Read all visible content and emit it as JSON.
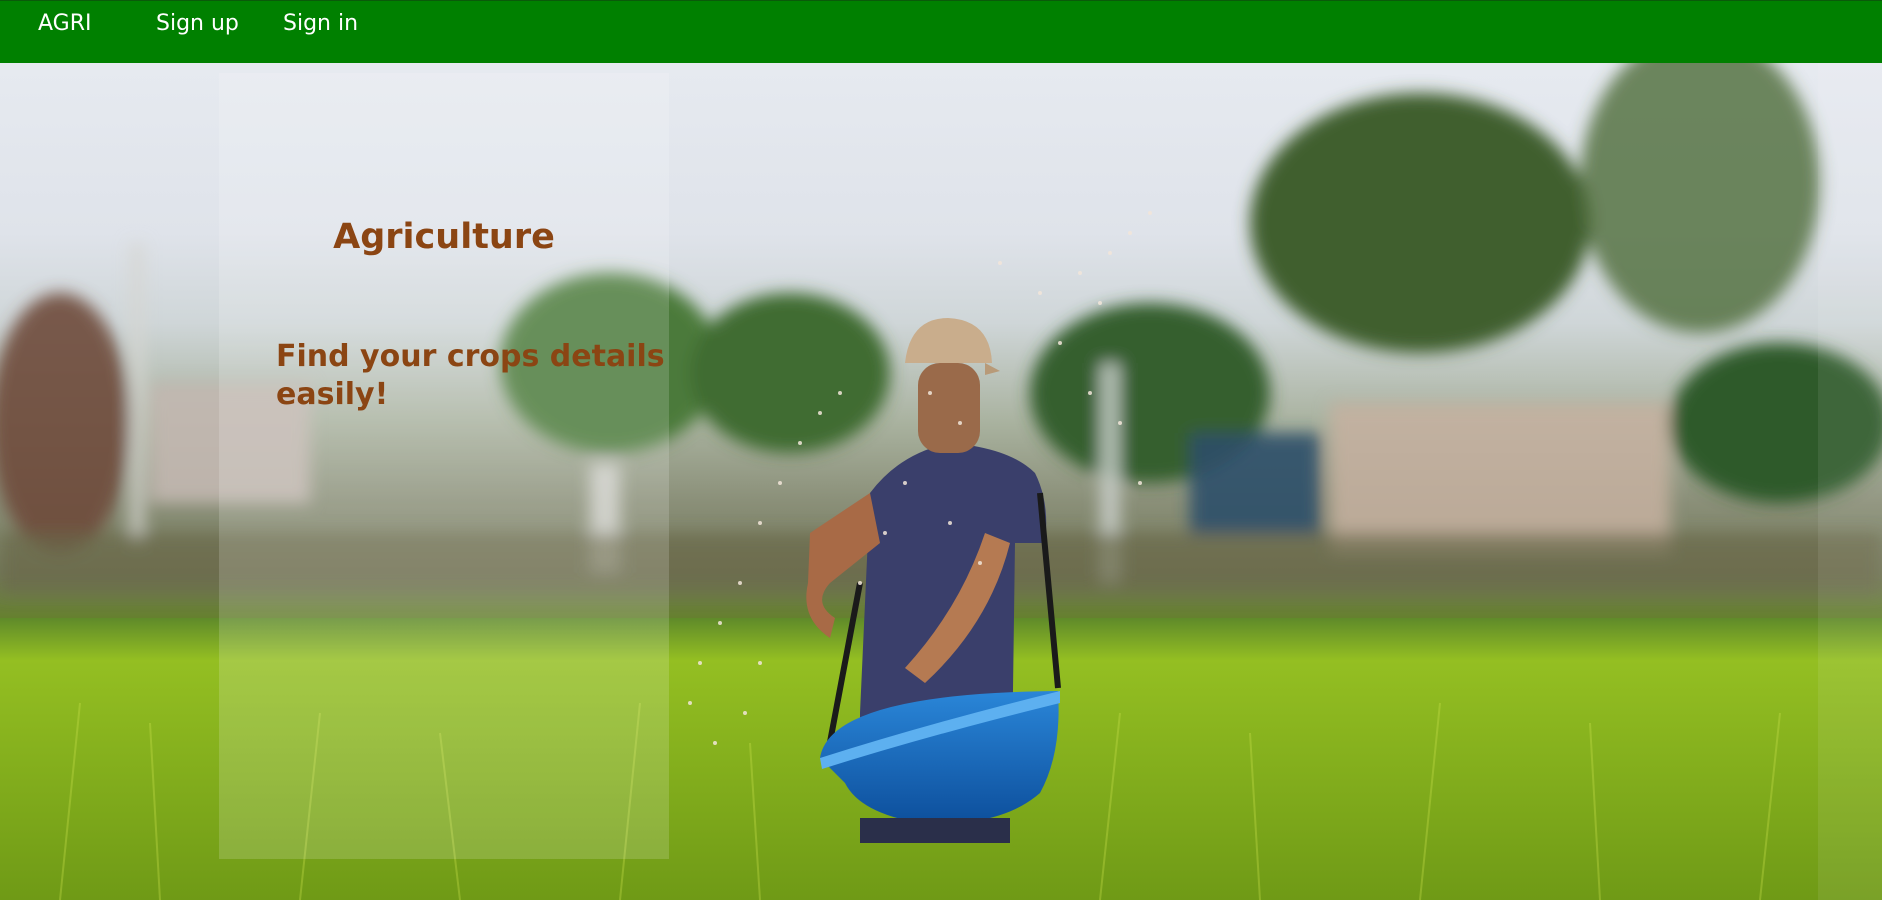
{
  "nav": {
    "brand": "AGRI",
    "signup": "Sign up",
    "signin": "Sign in"
  },
  "hero": {
    "title": "Agriculture",
    "tagline": "Find your crops details easily!"
  },
  "colors": {
    "navbar": "#008000",
    "heading": "#8b4513"
  }
}
